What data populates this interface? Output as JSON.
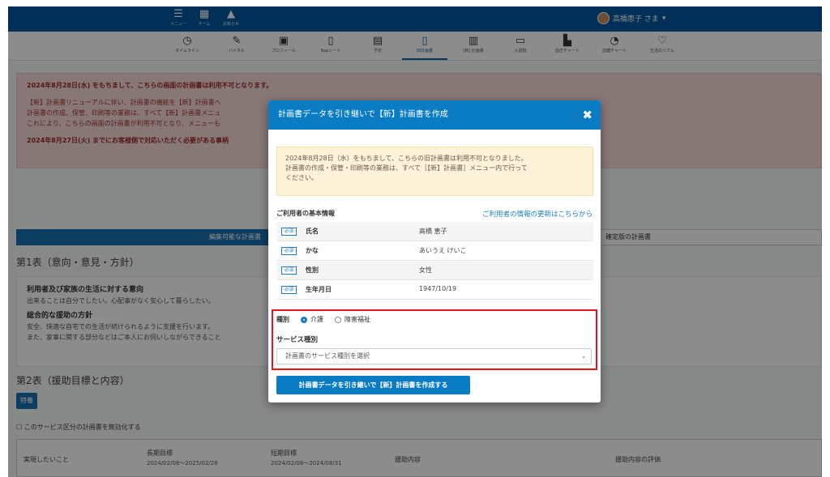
{
  "topbar": {
    "items": [
      {
        "label": "メニュー",
        "icon": "hamburger-icon"
      },
      {
        "label": "チーム",
        "icon": "grid-icon"
      },
      {
        "label": "お知らせ",
        "icon": "bell-icon"
      }
    ],
    "user": "高橋恵子 さま"
  },
  "nav": {
    "items": [
      {
        "label": "タイムライン"
      },
      {
        "label": "バイタル"
      },
      {
        "label": "プロフィール"
      },
      {
        "label": "Nspシート"
      },
      {
        "label": "予定"
      },
      {
        "label": "旧計画書"
      },
      {
        "label": "[新] 計画書"
      },
      {
        "label": "入退院"
      },
      {
        "label": "血圧チャート"
      },
      {
        "label": "血糖チャート"
      },
      {
        "label": "生活のリズム"
      }
    ],
    "active": 5
  },
  "alert": {
    "line1": "2024年8月28日(水) をもちまして、こちらの画面の計画書は利用不可となります。",
    "line2": "【新】計画書リニューアルに伴い、計画書の機能を【新】計画書へ",
    "line3": "計画書の作成、保管、印刷等の業務は、すべて【新】計画書メニュ",
    "line4": "これにより、こちらの画面の計画書が利用不可となり、メニューも",
    "line5": "2024年8月27日(火) までにお客様側で対応いただく必要がある事柄"
  },
  "tabs": {
    "editable": "編集可能な計画書",
    "confirmed": "確定版の計画書"
  },
  "section1": {
    "title": "第1表（意向・意見・方針）",
    "intent_title": "利用者及び家族の生活に対する意向",
    "intent_text": "出来ることは自分でしたい。心配事がなく安心して暮らしたい。",
    "policy_title": "総合的な援助の方針",
    "policy_text1": "安全、快適な自宅での生活が続けられるように支援を行います。",
    "policy_text2": "また、家事に関する部分などはご本人にお伺いしながらできること"
  },
  "section2": {
    "title": "第2表（援助目標と内容）",
    "chip": "特養",
    "checkbox_label": "このサービス区分の計画書を無効化する"
  },
  "table": {
    "col1": "実現したいこと",
    "col2": "長期目標",
    "col2_sub": "2024/02/08〜2025/02/28",
    "col3": "短期目標",
    "col3_sub": "2024/02/08〜2024/08/31",
    "col4": "援助内容",
    "col5": "援助内容の評価"
  },
  "modal": {
    "title": "計画書データを引き継いで【新】計画書を作成",
    "close": "✖",
    "notice1": "2024年8月28日（水）をもちまして、こちらの旧計画書は利用不可となりました。",
    "notice2": "計画書の作成・保管・印刷等の業務は、すべて［【新】計画書］メニュー内で行って",
    "notice3": "ください。",
    "section": "ご利用者の基本情報",
    "link": "ご利用者の情報の更新はこちらから",
    "required": "必須",
    "rows": [
      {
        "label": "氏名",
        "value": "高橋 恵子"
      },
      {
        "label": "かな",
        "value": "あいうえ けいこ"
      },
      {
        "label": "性別",
        "value": "女性"
      },
      {
        "label": "生年月日",
        "value": "1947/10/19"
      }
    ],
    "kind_label": "種別",
    "kind_options": [
      "介護",
      "障害福祉"
    ],
    "kind_selected": 0,
    "service_label": "サービス種別",
    "select_placeholder": "計画書のサービス種別を選択",
    "submit": "計画書データを引き継いで【新】計画書を作成する"
  }
}
